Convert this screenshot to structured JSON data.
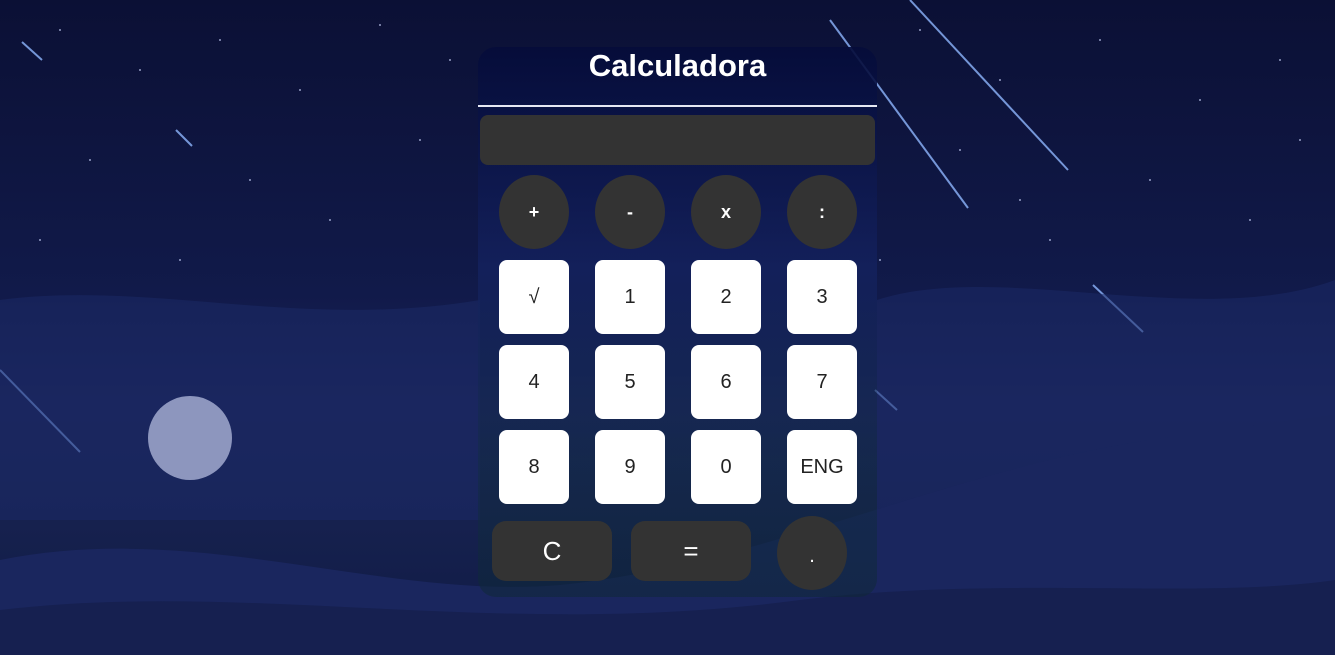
{
  "app": {
    "title": "Calculadora",
    "display_value": ""
  },
  "operators": [
    {
      "label": "+"
    },
    {
      "label": "-"
    },
    {
      "label": "x"
    },
    {
      "label": ":"
    }
  ],
  "keys": [
    {
      "label": "√"
    },
    {
      "label": "1"
    },
    {
      "label": "2"
    },
    {
      "label": "3"
    },
    {
      "label": "4"
    },
    {
      "label": "5"
    },
    {
      "label": "6"
    },
    {
      "label": "7"
    },
    {
      "label": "8"
    },
    {
      "label": "9"
    },
    {
      "label": "0"
    },
    {
      "label": "ENG"
    }
  ],
  "bottom": {
    "clear": "C",
    "equals": "=",
    "dot": "."
  },
  "colors": {
    "key_dark": "#333333",
    "key_light": "#ffffff",
    "background": "#111a4a"
  }
}
